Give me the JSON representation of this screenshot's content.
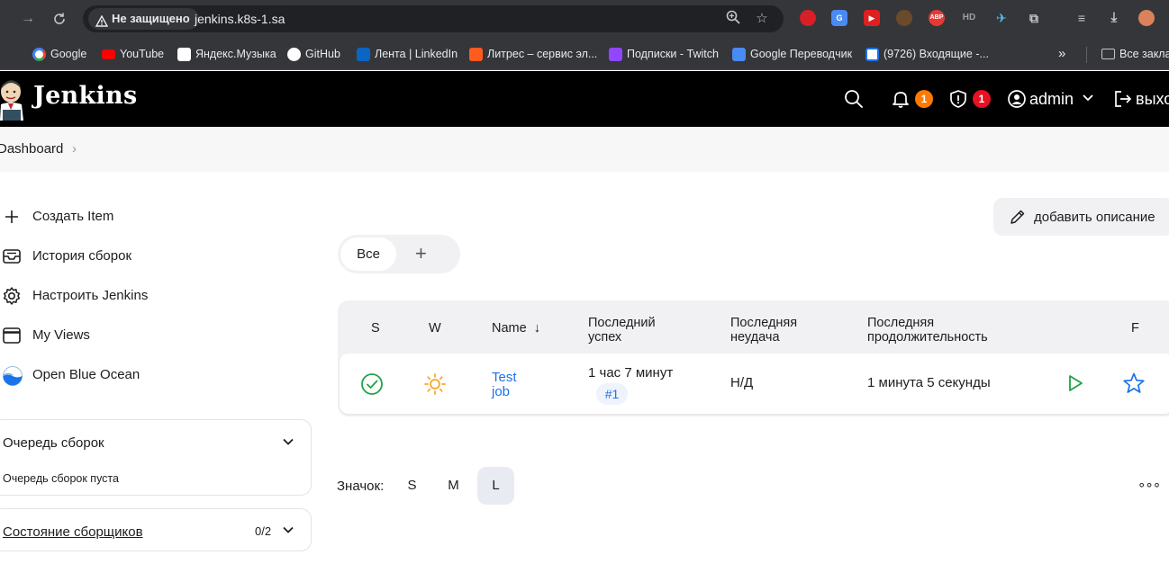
{
  "browser": {
    "security_label": "Не защищено",
    "url": "jenkins.k8s-1.sa",
    "extensions": [
      "ABP",
      "HD"
    ],
    "bookmarks": [
      "Google",
      "YouTube",
      "Яндекс.Музыка",
      "GitHub",
      "Лента | LinkedIn",
      "Литрес – сервис эл...",
      "Подписки - Twitch",
      "Google Переводчик",
      "(9726) Входящие -..."
    ],
    "bookmarks_more": "»",
    "all_bookmarks": "Все закла"
  },
  "header": {
    "brand": "Jenkins",
    "notifications_count": "1",
    "security_count": "1",
    "user": "admin",
    "logout": "выхо"
  },
  "breadcrumb": {
    "dashboard": "Dashboard",
    "separator": "›"
  },
  "sidebar": {
    "tasks": [
      {
        "label": "Создать Item",
        "icon": "plus-icon"
      },
      {
        "label": "История сборок",
        "icon": "inbox-icon"
      },
      {
        "label": "Настроить Jenkins",
        "icon": "gear-icon"
      },
      {
        "label": "My Views",
        "icon": "window-icon"
      },
      {
        "label": "Open Blue Ocean",
        "icon": "blue-ocean-icon"
      }
    ],
    "build_queue": {
      "title": "Очередь сборок",
      "empty_text": "Очередь сборок пуста"
    },
    "executors": {
      "title": "Состояние сборщиков",
      "count": "0/2"
    }
  },
  "main": {
    "add_description": "добавить описание",
    "tabs": {
      "all": "Все",
      "add": "+"
    },
    "table": {
      "headers": {
        "s": "S",
        "w": "W",
        "name": "Name",
        "name_sort": "↓",
        "last_success_1": "Последний",
        "last_success_2": "успех",
        "last_failure_1": "Последняя",
        "last_failure_2": "неудача",
        "last_duration_1": "Последняя",
        "last_duration_2": "продолжительность",
        "f": "F"
      },
      "rows": [
        {
          "name_1": "Test",
          "name_2": "job",
          "last_success": "1 час 7 минут",
          "build_number": "#1",
          "last_failure": "Н/Д",
          "last_duration": "1 минута 5 секунды",
          "status": "success",
          "weather": "sunny"
        }
      ]
    },
    "icon_size": {
      "label": "Значок:",
      "options": [
        "S",
        "M",
        "L"
      ],
      "selected": "L"
    },
    "more": "∘∘∘"
  },
  "colors": {
    "success": "#1ea446",
    "weather_sun": "#f5a623",
    "link": "#1a73e8",
    "notif_badge": "#ff7a00",
    "security_badge": "#e81123"
  }
}
